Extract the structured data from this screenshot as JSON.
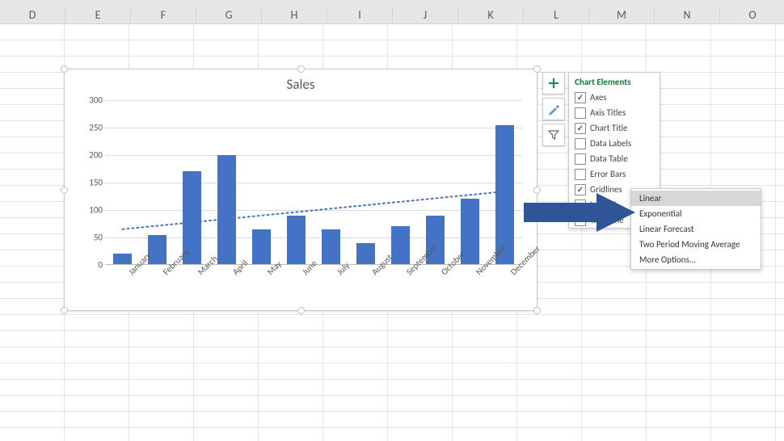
{
  "columns": [
    "D",
    "E",
    "F",
    "G",
    "H",
    "I",
    "J",
    "K",
    "L",
    "M",
    "N",
    "O"
  ],
  "chart": {
    "title": "Sales"
  },
  "chart_data": {
    "type": "bar",
    "title": "Sales",
    "xlabel": "",
    "ylabel": "",
    "categories": [
      "January",
      "February",
      "March",
      "April",
      "May",
      "June",
      "July",
      "August",
      "September",
      "October",
      "November",
      "December"
    ],
    "values": [
      20,
      55,
      170,
      200,
      65,
      90,
      65,
      40,
      70,
      90,
      120,
      255
    ],
    "ylim": [
      0,
      300
    ],
    "ytick_step": 50,
    "trendline": {
      "type": "linear",
      "start": 65,
      "end": 135,
      "style": "dotted"
    }
  },
  "side_buttons": [
    "plus-icon",
    "brush-icon",
    "funnel-icon"
  ],
  "chart_elements": {
    "title": "Chart Elements",
    "items": [
      {
        "label": "Axes",
        "checked": true
      },
      {
        "label": "Axis Titles",
        "checked": false
      },
      {
        "label": "Chart Title",
        "checked": true
      },
      {
        "label": "Data Labels",
        "checked": false
      },
      {
        "label": "Data Table",
        "checked": false
      },
      {
        "label": "Error Bars",
        "checked": false
      },
      {
        "label": "Gridlines",
        "checked": true
      },
      {
        "label": "Legend",
        "checked": false
      },
      {
        "label": "Trendline",
        "checked": false,
        "expanded": true
      }
    ]
  },
  "trend_submenu": {
    "items": [
      "Linear",
      "Exponential",
      "Linear Forecast",
      "Two Period Moving Average",
      "More Options..."
    ],
    "highlighted": 0
  }
}
